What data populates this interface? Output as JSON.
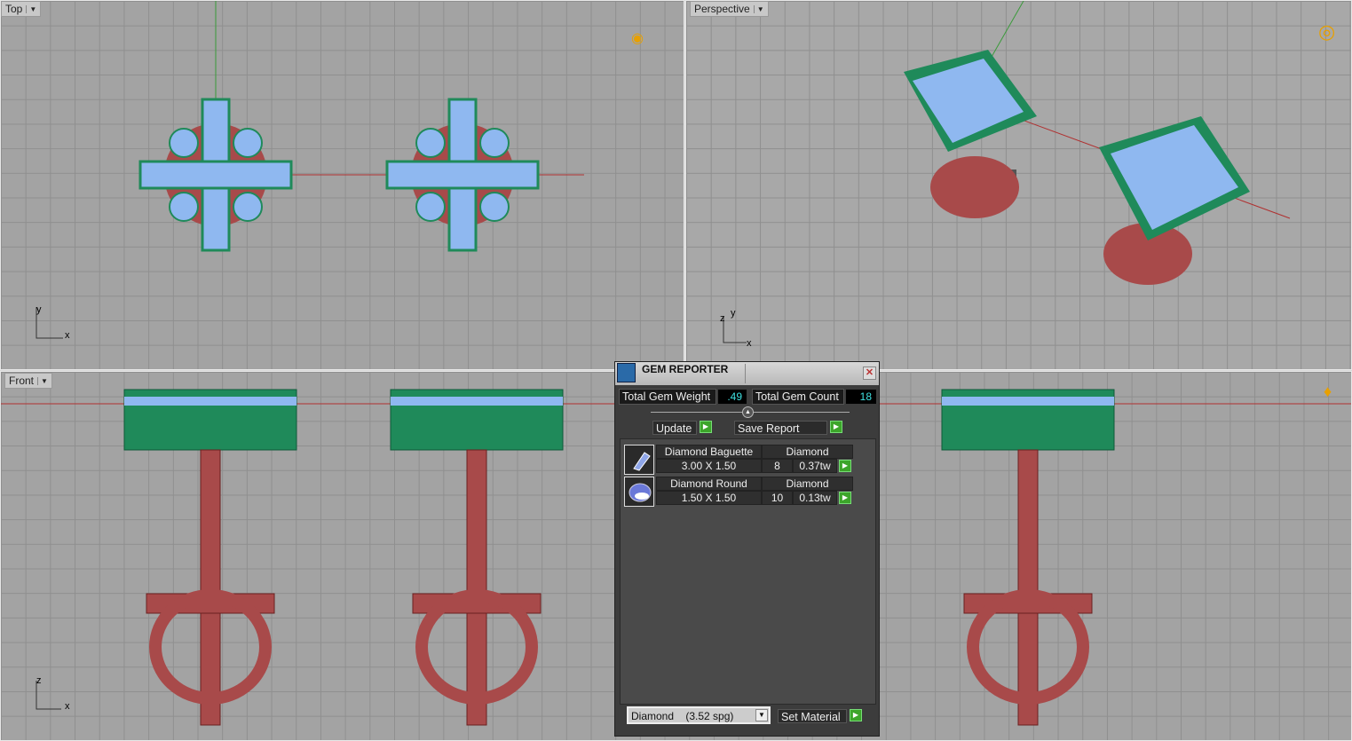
{
  "viewports": {
    "top": "Top",
    "perspective": "Perspective",
    "front": "Front"
  },
  "axes": {
    "x": "x",
    "y": "y",
    "z": "z"
  },
  "panel": {
    "title": "GEM REPORTER",
    "total_weight_label": "Total Gem Weight",
    "total_weight": ".49",
    "total_count_label": "Total Gem Count",
    "total_count": "18",
    "update": "Update",
    "save_report": "Save Report",
    "gems": [
      {
        "name": "Diamond Baguette",
        "material": "Diamond",
        "size": "3.00 X 1.50",
        "count": "8",
        "weight": "0.37tw"
      },
      {
        "name": "Diamond Round",
        "material": "Diamond",
        "size": "1.50 X 1.50",
        "count": "10",
        "weight": "0.13tw"
      }
    ],
    "material_select": "Diamond    (3.52 spg)",
    "set_material": "Set Material"
  },
  "colors": {
    "prong": "#1f8a5a",
    "gem": "#8fb8f0",
    "metal": "#a84a4a"
  }
}
